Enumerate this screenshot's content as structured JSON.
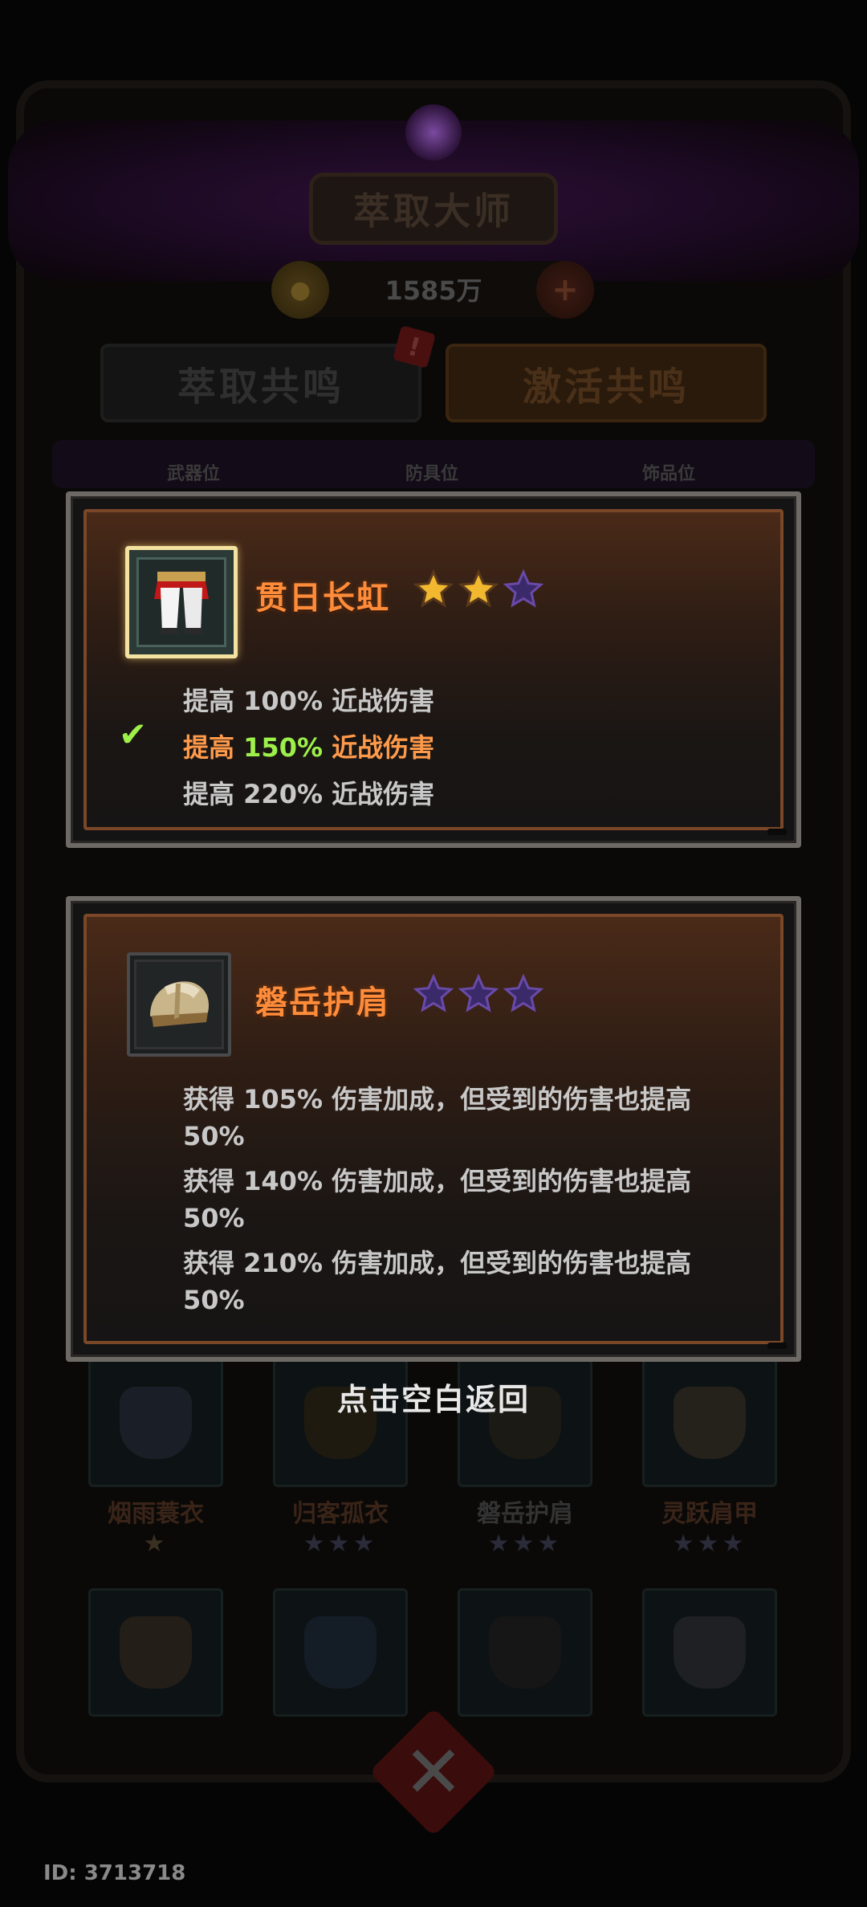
{
  "background": {
    "title": "萃取大师",
    "currency": "1585万",
    "tabs": [
      "萃取共鸣",
      "激活共鸣"
    ],
    "slot_labels": [
      "武器位",
      "防具位",
      "饰品位"
    ],
    "items": [
      {
        "name": "烟雨蓑衣",
        "stars": "★"
      },
      {
        "name": "归客孤衣",
        "stars": "★★★"
      },
      {
        "name": "磐岳护肩",
        "stars": "★★★"
      },
      {
        "name": "灵跃肩甲",
        "stars": "★★★"
      }
    ]
  },
  "panels": [
    {
      "name": "贯日长虹",
      "stars_filled": 2,
      "stars_total": 3,
      "icon": "pants-icon",
      "effects": [
        {
          "text": "提高 ",
          "pct": "100%",
          "tail": " 近战伤害",
          "active": false
        },
        {
          "text": "提高 ",
          "pct": "150%",
          "tail": " 近战伤害",
          "active": true
        },
        {
          "text": "提高 ",
          "pct": "220%",
          "tail": " 近战伤害",
          "active": false
        }
      ]
    },
    {
      "name": "磐岳护肩",
      "stars_filled": 0,
      "stars_total": 3,
      "icon": "shoulder-armor-icon",
      "effects": [
        {
          "text": "获得 105% 伤害加成，但受到的伤害也提高 50%"
        },
        {
          "text": "获得 140% 伤害加成，但受到的伤害也提高 50%"
        },
        {
          "text": "获得 210% 伤害加成，但受到的伤害也提高 50%"
        }
      ]
    }
  ],
  "hint": "点击空白返回",
  "footer_id": "ID: 3713718",
  "colors": {
    "name": "#ff8c3a",
    "active_effect": "#ff9a4a",
    "active_pct": "#9df04a",
    "star_gold": "#f2b830",
    "star_empty": "#3a2a6a"
  }
}
